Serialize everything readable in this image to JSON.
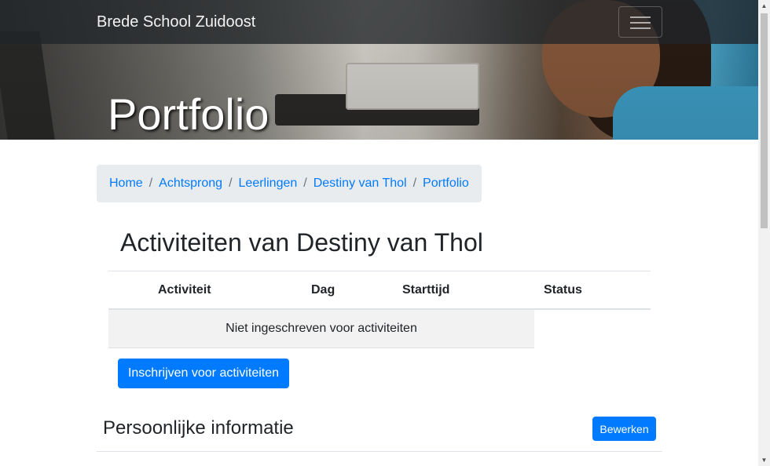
{
  "navbar": {
    "brand": "Brede School Zuidoost",
    "toggler_icon": "hamburger-icon"
  },
  "hero": {
    "title": "Portfolio"
  },
  "breadcrumb": {
    "items": [
      "Home",
      "Achtsprong",
      "Leerlingen",
      "Destiny van Thol",
      "Portfolio"
    ],
    "separator": "/"
  },
  "activities": {
    "heading": "Activiteiten van Destiny van Thol",
    "columns": [
      "Activiteit",
      "Dag",
      "Starttijd",
      "Status"
    ],
    "empty_message": "Niet ingeschreven voor activiteiten",
    "enroll_button": "Inschrijven voor activiteiten"
  },
  "personal": {
    "heading": "Persoonlijke informatie",
    "edit_button": "Bewerken"
  },
  "colors": {
    "primary": "#007bff",
    "breadcrumb_bg": "#e9ecef",
    "navbar_bg": "#212529"
  }
}
